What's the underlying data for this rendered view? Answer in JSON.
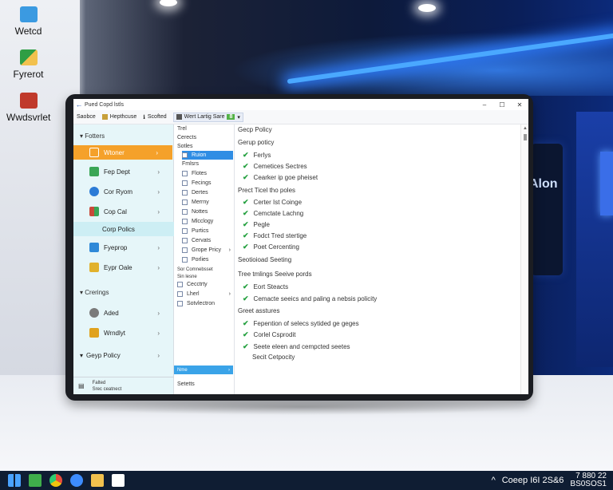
{
  "desktop_icons": [
    {
      "label": "Wetcd",
      "icon": "monitor-icon",
      "color": "#3b9ae1"
    },
    {
      "label": "Fyrerot",
      "icon": "app-grid-icon",
      "color": "#2f9e44"
    },
    {
      "label": "Wwdsvrlet",
      "icon": "app-red-icon",
      "color": "#c0392b"
    }
  ],
  "wall_text": "Alon",
  "window": {
    "title": "Pued  Copd lstls",
    "controls": [
      "–",
      "☐",
      "✕"
    ]
  },
  "toolbar": {
    "item1": "Saobce",
    "item2": "Hepthcuse",
    "item3": "Scofted",
    "item4": "Wert Lartig Sare",
    "badge": "8",
    "dropdown": "▾"
  },
  "left_panel": {
    "header1": "Fotters",
    "items": [
      {
        "label": "Wtoner",
        "icon": "pencil-icon",
        "color": "#ffffff"
      },
      {
        "label": "Fep Dept",
        "icon": "grid-icon",
        "color": "#3aa656"
      },
      {
        "label": "Cor Ryom",
        "icon": "chrome-icon",
        "color": "#2b7bd6"
      },
      {
        "label": "Cop Cal",
        "icon": "grid-red-icon",
        "color": "#c94a3a"
      },
      {
        "label": "Corp Polics",
        "icon": "",
        "color": ""
      },
      {
        "label": "Fyeprop",
        "icon": "window-icon",
        "color": "#2f89d8"
      },
      {
        "label": "Eypr Oale",
        "icon": "folder-icon",
        "color": "#e1b12c"
      }
    ],
    "header2": "Crerings",
    "items2": [
      {
        "label": "Aded",
        "icon": "gear-icon",
        "color": "#7a7a7a"
      },
      {
        "label": "Wrndlyt",
        "icon": "bolt-icon",
        "color": "#e0a21d"
      },
      {
        "label": "Geyp Policy",
        "icon": "",
        "color": ""
      }
    ],
    "footer_line1": "Falted",
    "footer_line2": "Srec ceatnect"
  },
  "middle_panel": {
    "rows": [
      "Trel",
      "Cerects",
      "Sotles",
      "Ruion",
      "Fmlsrs",
      "Flotes",
      "Fecings",
      "Dertes",
      "Merrny",
      "Nottes",
      "Mlcclogy",
      "Purtics",
      "Cervats",
      "Grope Pricy",
      "Porlies"
    ],
    "section2": [
      "Sor Comnebsset",
      "Sin lesne"
    ],
    "rows2": [
      "Cecctrty",
      "Lherl",
      "Sotvlectron"
    ],
    "bottom_selected": "Nme",
    "status": "Setetts"
  },
  "right_panel": {
    "title": "Gecp Policy",
    "group1": "Gerup poticy",
    "g1_items": [
      "Ferlys",
      "Cemetices Sectres",
      "Cearker ip goe pheiset"
    ],
    "group2": "Prect Ticel tho poles",
    "g2_items": [
      "Certer Ist Coinge",
      "Cemctate Lachng",
      "Pegle",
      "Fodct Tred stertige",
      "Poet Cercenting"
    ],
    "group3": "Seotioioad Seeting",
    "group4": "Tree tmlings Seeive pords",
    "g4_items": [
      "Eort Steacts",
      "Cemacte seeics and paling a nebsis policity"
    ],
    "group5": "Greet asstures",
    "g5_items": [
      "Fepention of selecs sytided ge geges",
      "Corlel Csprodit",
      "Seete eleen and cempcted seetes",
      "Secit Cetpocity"
    ]
  },
  "taskbar": {
    "icons": [
      {
        "name": "windows-start-icon",
        "color": "#4aa3ff"
      },
      {
        "name": "app-green-icon",
        "color": "#3fae4b"
      },
      {
        "name": "chrome-icon",
        "color": "#e74c3c"
      },
      {
        "name": "edge-icon",
        "color": "#3d8cff"
      },
      {
        "name": "explorer-icon",
        "color": "#f2c14e"
      },
      {
        "name": "notes-icon",
        "color": "#ffffff"
      }
    ],
    "tray_text": "Coeep  I6I  2S&6",
    "clock_time": "7 880 22",
    "clock_date": "BS0SOS1"
  }
}
